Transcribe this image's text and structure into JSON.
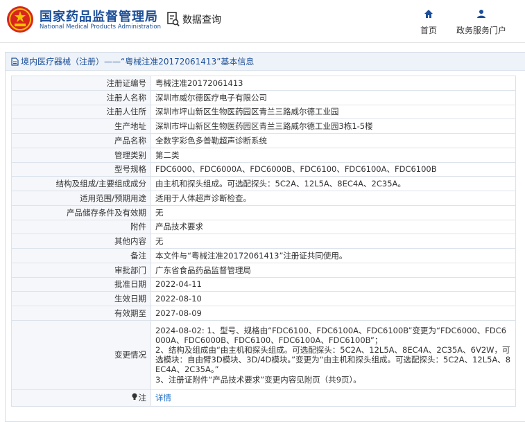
{
  "header": {
    "site_name": "国家药品监督管理局",
    "site_name_en": "National Medical Products Administration",
    "data_query_label": "数据查询",
    "nav": [
      {
        "label": "首页",
        "icon": "home-icon"
      },
      {
        "label": "政务服务门户",
        "icon": "user-icon"
      }
    ],
    "brand_color": "#1d4f98"
  },
  "panel": {
    "title": "境内医疗器械（注册）——“粤械注准20172061413”基本信息"
  },
  "rows": [
    {
      "label": "注册证编号",
      "value": "粤械注准20172061413"
    },
    {
      "label": "注册人名称",
      "value": "深圳市威尔德医疗电子有限公司"
    },
    {
      "label": "注册人住所",
      "value": "深圳市坪山新区生物医药园区青兰三路威尔德工业园"
    },
    {
      "label": "生产地址",
      "value": "深圳市坪山新区生物医药园区青兰三路威尔德工业园3栋1-5楼"
    },
    {
      "label": "产品名称",
      "value": "全数字彩色多普勒超声诊断系统"
    },
    {
      "label": "管理类别",
      "value": "第二类"
    },
    {
      "label": "型号规格",
      "value": "FDC6000、FDC6000A、FDC6000B、FDC6100、FDC6100A、FDC6100B"
    },
    {
      "label": "结构及组成/主要组成成分",
      "value": "由主机和探头组成。可选配探头：5C2A、12L5A、8EC4A、2C35A。"
    },
    {
      "label": "适用范围/预期用途",
      "value": "适用于人体超声诊断检查。"
    },
    {
      "label": "产品储存条件及有效期",
      "value": "无"
    },
    {
      "label": "附件",
      "value": "产品技术要求"
    },
    {
      "label": "其他内容",
      "value": "无"
    },
    {
      "label": "备注",
      "value": "本文件与“粤械注准20172061413”注册证共同使用。"
    },
    {
      "label": "审批部门",
      "value": "广东省食品药品监督管理局"
    },
    {
      "label": "批准日期",
      "value": "2022-04-11"
    },
    {
      "label": "生效日期",
      "value": "2022-08-10"
    },
    {
      "label": "有效期至",
      "value": "2027-08-09"
    }
  ],
  "changes": {
    "label": "变更情况",
    "lines": [
      "2024-08-02: 1、型号、规格由“FDC6100、FDC6100A、FDC6100B”变更为“FDC6000、FDC6000A、FDC6000B、FDC6100、FDC6100A、FDC6100B”；",
      "2、结构及组成由“由主机和探头组成。可选配探头：5C2A、12L5A、8EC4A、2C35A、6V2W，可选模块：自由臂3D模块、3D/4D模块。”变更为“由主机和探头组成。可选配探头：5C2A、12L5A、8EC4A、2C35A。”",
      "3、注册证附件“产品技术要求”变更内容见附页（共9页）。"
    ]
  },
  "note": {
    "label": "注",
    "link_text": "详情"
  }
}
